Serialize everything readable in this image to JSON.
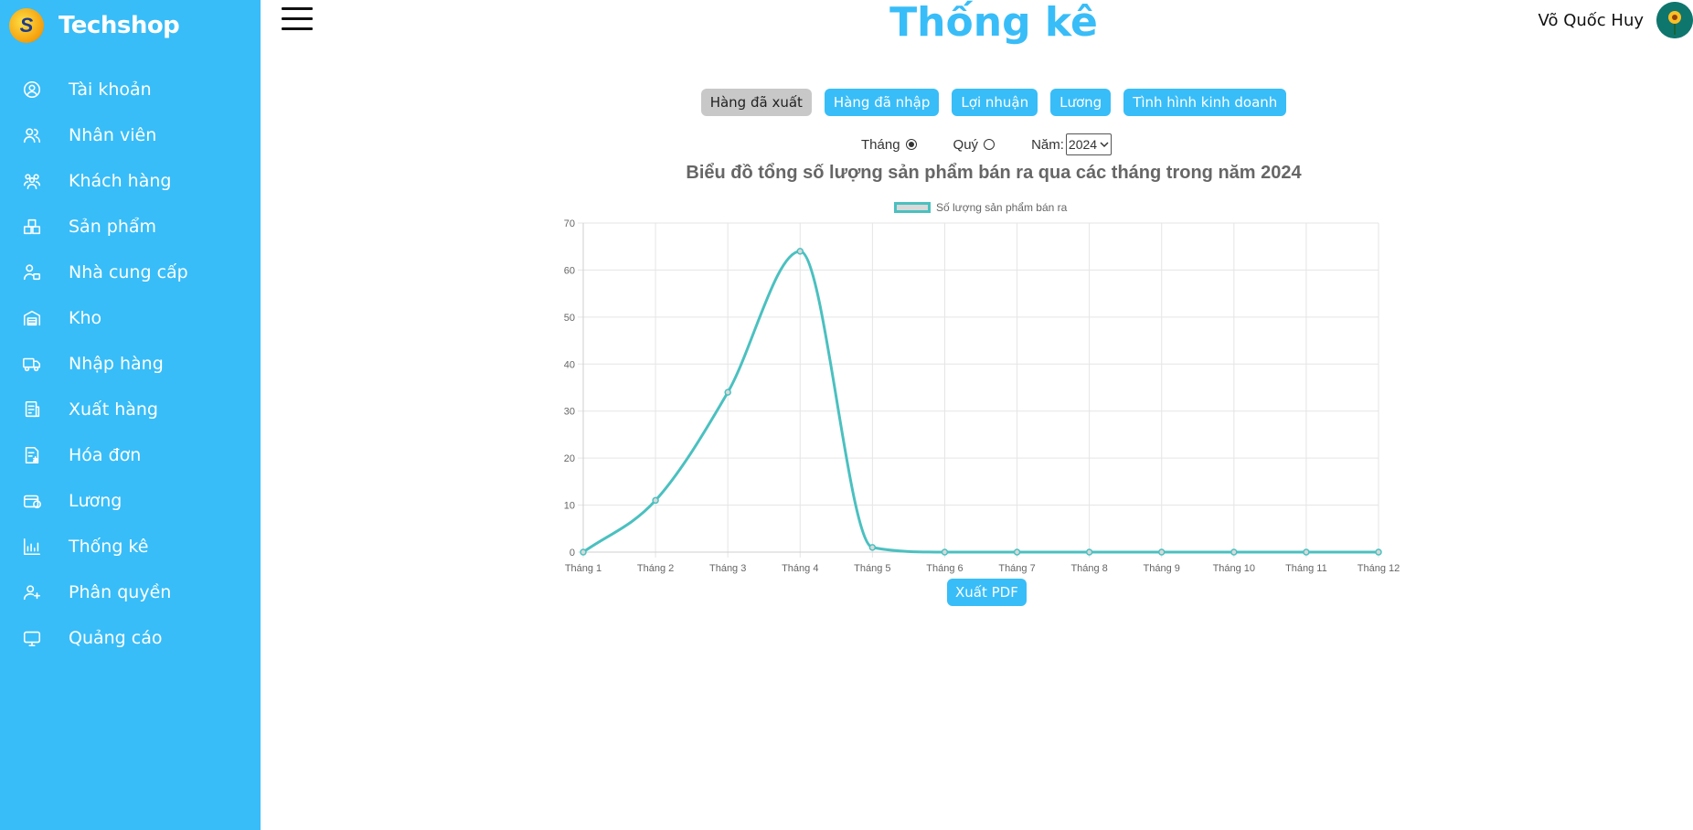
{
  "brand": {
    "name": "Techshop",
    "logo_icon": "techshop-logo-icon"
  },
  "sidebar": {
    "items": [
      {
        "label": "Tài khoản",
        "icon": "account-icon"
      },
      {
        "label": "Nhân viên",
        "icon": "staff-icon"
      },
      {
        "label": "Khách hàng",
        "icon": "customers-icon"
      },
      {
        "label": "Sản phẩm",
        "icon": "products-icon"
      },
      {
        "label": "Nhà cung cấp",
        "icon": "supplier-icon"
      },
      {
        "label": "Kho",
        "icon": "warehouse-icon"
      },
      {
        "label": "Nhập hàng",
        "icon": "import-icon"
      },
      {
        "label": "Xuất hàng",
        "icon": "export-icon"
      },
      {
        "label": "Hóa đơn",
        "icon": "invoice-icon"
      },
      {
        "label": "Lương",
        "icon": "salary-icon"
      },
      {
        "label": "Thống kê",
        "icon": "statistics-icon"
      },
      {
        "label": "Phân quyền",
        "icon": "permissions-icon"
      },
      {
        "label": "Quảng cáo",
        "icon": "ads-icon"
      }
    ]
  },
  "header": {
    "title": "Thống kê",
    "user_name": "Võ Quốc Huy"
  },
  "tabs": [
    {
      "label": "Hàng đã xuất",
      "active": true
    },
    {
      "label": "Hàng đã nhập",
      "active": false
    },
    {
      "label": "Lợi nhuận",
      "active": false
    },
    {
      "label": "Lương",
      "active": false
    },
    {
      "label": "Tình hình kinh doanh",
      "active": false
    }
  ],
  "filters": {
    "month_label": "Tháng",
    "quarter_label": "Quý",
    "year_label": "Năm:",
    "year_value": "2024",
    "selected_period": "month"
  },
  "colors": {
    "accent": "#38bdf8",
    "line": "#4bc0c0",
    "active_tab": "#c8c8c8"
  },
  "chart_data": {
    "type": "line",
    "title": "Biểu đồ tổng số lượng sản phẩm bán ra qua các tháng trong năm 2024",
    "categories": [
      "Tháng 1",
      "Tháng 2",
      "Tháng 3",
      "Tháng 4",
      "Tháng 5",
      "Tháng 6",
      "Tháng 7",
      "Tháng 8",
      "Tháng 9",
      "Tháng 10",
      "Tháng 11",
      "Tháng 12"
    ],
    "series": [
      {
        "name": "Số lượng sản phẩm bán ra",
        "values": [
          0,
          11,
          34,
          64,
          1,
          0,
          0,
          0,
          0,
          0,
          0,
          0
        ]
      }
    ],
    "ylim": [
      0,
      70
    ],
    "yticks": [
      0,
      10,
      20,
      30,
      40,
      50,
      60,
      70
    ],
    "grid": true,
    "legend": "top-center",
    "xlabel": "",
    "ylabel": ""
  },
  "actions": {
    "export_pdf": "Xuất PDF"
  }
}
